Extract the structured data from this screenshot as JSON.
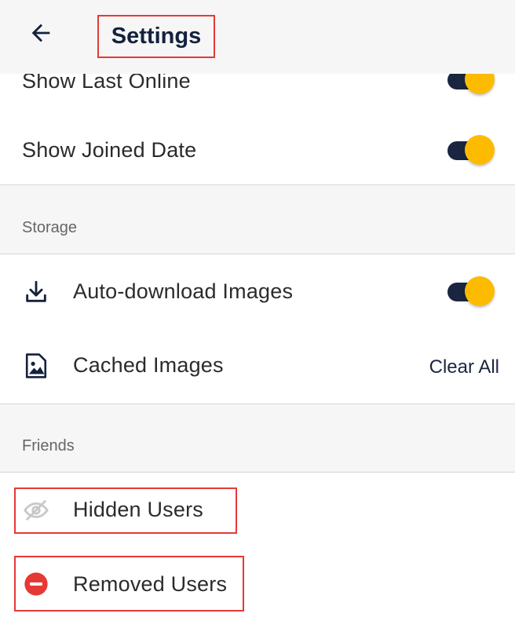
{
  "header": {
    "title": "Settings"
  },
  "privacy": {
    "show_last_online": {
      "label": "Show Last Online",
      "enabled": true
    },
    "show_joined_date": {
      "label": "Show Joined Date",
      "enabled": true
    }
  },
  "storage": {
    "section_title": "Storage",
    "auto_download": {
      "label": "Auto-download Images",
      "enabled": true,
      "icon": "download-icon"
    },
    "cached_images": {
      "label": "Cached Images",
      "action": "Clear All",
      "icon": "image-icon"
    }
  },
  "friends": {
    "section_title": "Friends",
    "hidden_users": {
      "label": "Hidden Users",
      "icon": "eye-off-icon"
    },
    "removed_users": {
      "label": "Removed Users",
      "icon": "remove-circle-icon"
    }
  },
  "colors": {
    "accent": "#fdbb00",
    "toggle_track": "#1a2640",
    "highlight": "#e53935",
    "remove": "#e53935"
  }
}
